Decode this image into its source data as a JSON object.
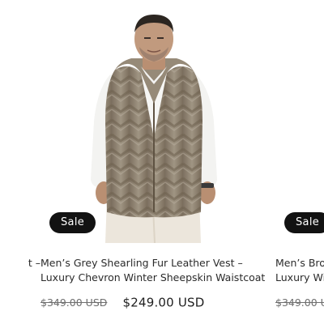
{
  "products": [
    {
      "title_line1": "t –",
      "title_line2": "",
      "badge": "",
      "price_old": "",
      "price_new": ""
    },
    {
      "title_line1": "Men’s Grey Shearling Fur Leather Vest –",
      "title_line2": "Luxury Chevron Winter Sheepskin Waistcoat",
      "badge": "Sale",
      "price_old": "$349.00 USD",
      "price_new": "$249.00 USD",
      "image_icon": "man-in-grey-fur-vest-photo"
    },
    {
      "title_line1": "Men’s Bro",
      "title_line2": "Luxury Wi",
      "badge": "Sale",
      "price_old": "$349.00 U",
      "price_new": ""
    }
  ],
  "colors": {
    "badge_bg": "#121212",
    "badge_text": "#ffffff",
    "vest": "#8a7d6c",
    "shirt": "#f3f3f1",
    "pants": "#ece6dc"
  }
}
